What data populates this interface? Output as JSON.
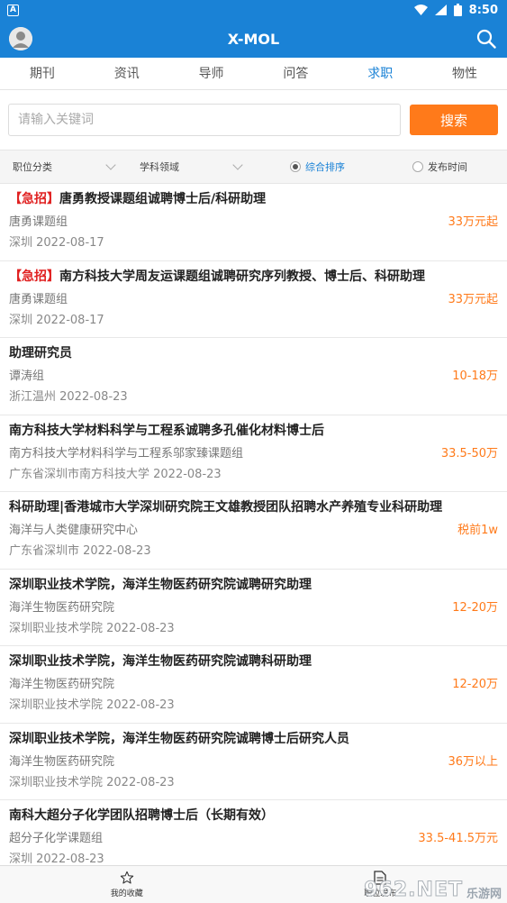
{
  "status_bar": {
    "badge": "A",
    "time": "8:50"
  },
  "app_bar": {
    "title": "X-MOL"
  },
  "tabs": [
    {
      "label": "期刊"
    },
    {
      "label": "资讯"
    },
    {
      "label": "导师"
    },
    {
      "label": "问答"
    },
    {
      "label": "求职"
    },
    {
      "label": "物性"
    }
  ],
  "search": {
    "placeholder": "请输入关键词",
    "button": "搜索"
  },
  "filters": {
    "category": "职位分类",
    "field": "学科领域",
    "sort_options": [
      {
        "label": "综合排序",
        "selected": true
      },
      {
        "label": "发布时间",
        "selected": false
      }
    ]
  },
  "jobs": [
    {
      "tag": "【急招】",
      "title": "唐勇教授课题组诚聘博士后/科研助理",
      "org": "唐勇课题组",
      "salary": "33万元起",
      "location": "深圳 2022-08-17"
    },
    {
      "tag": "【急招】",
      "title": "南方科技大学周友运课题组诚聘研究序列教授、博士后、科研助理",
      "org": "唐勇课题组",
      "salary": "33万元起",
      "location": "深圳 2022-08-17"
    },
    {
      "tag": "",
      "title": "助理研究员",
      "org": "谭涛组",
      "salary": "10-18万",
      "location": "浙江温州 2022-08-23"
    },
    {
      "tag": "",
      "title": "南方科技大学材料科学与工程系诚聘多孔催化材料博士后",
      "org": "南方科技大学材料科学与工程系邬家臻课题组",
      "salary": "33.5-50万",
      "location": "广东省深圳市南方科技大学 2022-08-23"
    },
    {
      "tag": "",
      "title": "科研助理|香港城市大学深圳研究院王文雄教授团队招聘水产养殖专业科研助理",
      "org": "海洋与人类健康研究中心",
      "salary": "税前1w",
      "location": "广东省深圳市 2022-08-23"
    },
    {
      "tag": "",
      "title": "深圳职业技术学院，海洋生物医药研究院诚聘研究助理",
      "org": "海洋生物医药研究院",
      "salary": "12-20万",
      "location": "深圳职业技术学院 2022-08-23"
    },
    {
      "tag": "",
      "title": "深圳职业技术学院，海洋生物医药研究院诚聘科研助理",
      "org": "海洋生物医药研究院",
      "salary": "12-20万",
      "location": "深圳职业技术学院 2022-08-23"
    },
    {
      "tag": "",
      "title": "深圳职业技术学院，海洋生物医药研究院诚聘博士后研究人员",
      "org": "海洋生物医药研究院",
      "salary": "36万以上",
      "location": "深圳职业技术学院 2022-08-23"
    },
    {
      "tag": "",
      "title": "南科大超分子化学团队招聘博士后（长期有效）",
      "org": "超分子化学课题组",
      "salary": "33.5-41.5万元",
      "location": "深圳 2022-08-23"
    }
  ],
  "bottom_nav": [
    {
      "label": "我的收藏",
      "icon": "star-icon"
    },
    {
      "label": "职位发布",
      "icon": "document-icon"
    }
  ],
  "watermark": {
    "number": "962.NET",
    "text": "乐游网"
  },
  "colors": {
    "primary": "#1a82d6",
    "accent": "#ff7a1a",
    "urgent": "#e02020"
  }
}
